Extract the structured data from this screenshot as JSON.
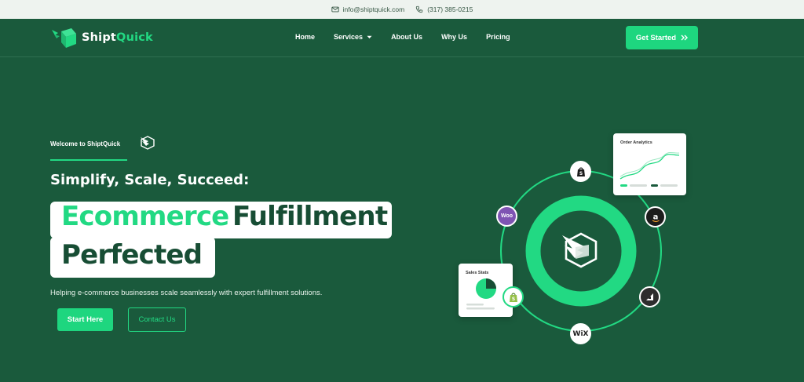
{
  "topbar": {
    "email": "info@shiptquick.com",
    "phone": "(317) 385-0215"
  },
  "brand": {
    "name_prefix": "Shipt",
    "name_suffix": "Quick",
    "accent": "#22d983",
    "background": "#1a5a3c"
  },
  "nav": {
    "items": [
      {
        "label": "Home"
      },
      {
        "label": "Services",
        "has_dropdown": true
      },
      {
        "label": "About Us"
      },
      {
        "label": "Why Us"
      },
      {
        "label": "Pricing"
      }
    ],
    "cta_label": "Get Started"
  },
  "hero": {
    "welcome": "Welcome to ShiptQuick",
    "subtitle": "Simplify, Scale, Succeed:",
    "headline_green": "Ecommerce",
    "headline_dark_1": "Fulfillment",
    "headline_dark_2": "Perfected",
    "description": "Helping e-commerce businesses scale seamlessly with expert fulfillment solutions.",
    "primary_button": "Start Here",
    "secondary_button": "Contact Us"
  },
  "graphic": {
    "analytics_card_title": "Order Analytics",
    "stats_card_title": "Sales Stats",
    "platforms": [
      {
        "name": "shopify-icon"
      },
      {
        "name": "amazon-icon"
      },
      {
        "name": "bigcommerce-icon"
      },
      {
        "name": "wix-icon",
        "label": "WiX"
      },
      {
        "name": "woocommerce-icon",
        "label": "Woo"
      }
    ]
  }
}
